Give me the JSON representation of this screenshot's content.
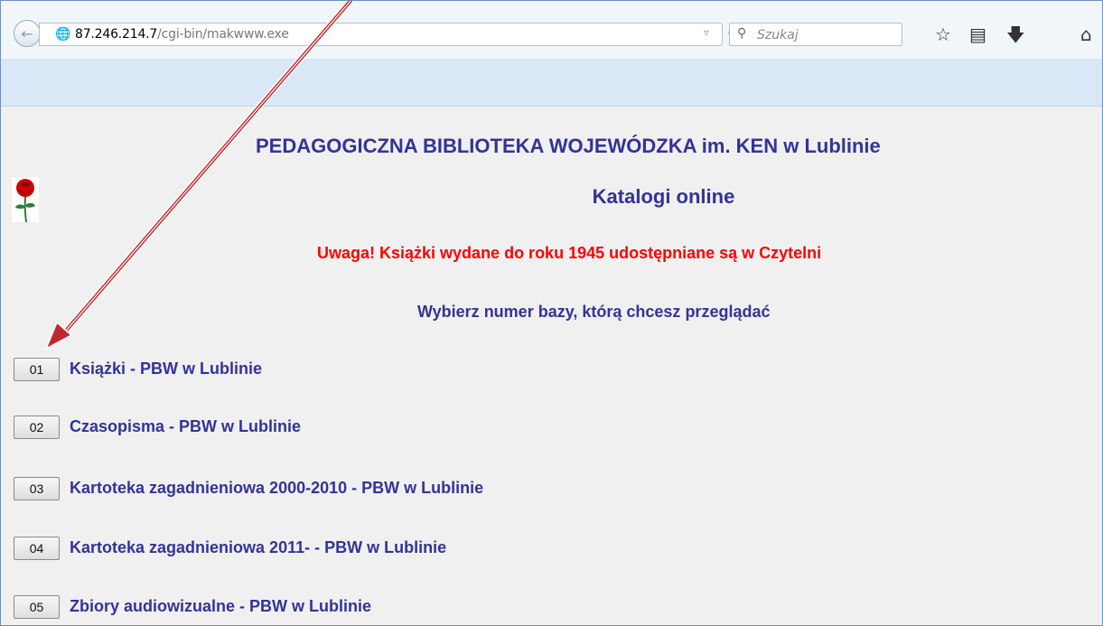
{
  "browser": {
    "url_host": "87.246.214.7",
    "url_path": "/cgi-bin/makwww.exe",
    "search_placeholder": "Szukaj"
  },
  "page": {
    "title": "PEDAGOGICZNA BIBLIOTEKA WOJEWÓDZKA im. KEN w Lublinie",
    "subtitle": "Katalogi online",
    "notice": "Uwaga! Książki wydane do roku 1945 udostępniane są w Czytelni",
    "instruction": "Wybierz numer bazy, którą chcesz przeglądać",
    "databases": [
      {
        "number": "01",
        "label": "Książki - PBW w Lublinie"
      },
      {
        "number": "02",
        "label": "Czasopisma - PBW w Lublinie"
      },
      {
        "number": "03",
        "label": "Kartoteka zagadnieniowa 2000-2010 - PBW w Lublinie"
      },
      {
        "number": "04",
        "label": "Kartoteka zagadnieniowa 2011- - PBW w Lublinie"
      },
      {
        "number": "05",
        "label": "Zbiory audiowizualne - PBW w Lublinie"
      }
    ]
  },
  "colors": {
    "heading": "#33339a",
    "notice": "#ff0000",
    "annotation_arrow": "#c1272d"
  },
  "icons": [
    "back-arrow-icon",
    "globe-icon",
    "dropdown-icon",
    "reload-icon",
    "search-icon",
    "bookmark-star-icon",
    "reading-list-icon",
    "download-icon",
    "home-icon",
    "rose-image"
  ]
}
